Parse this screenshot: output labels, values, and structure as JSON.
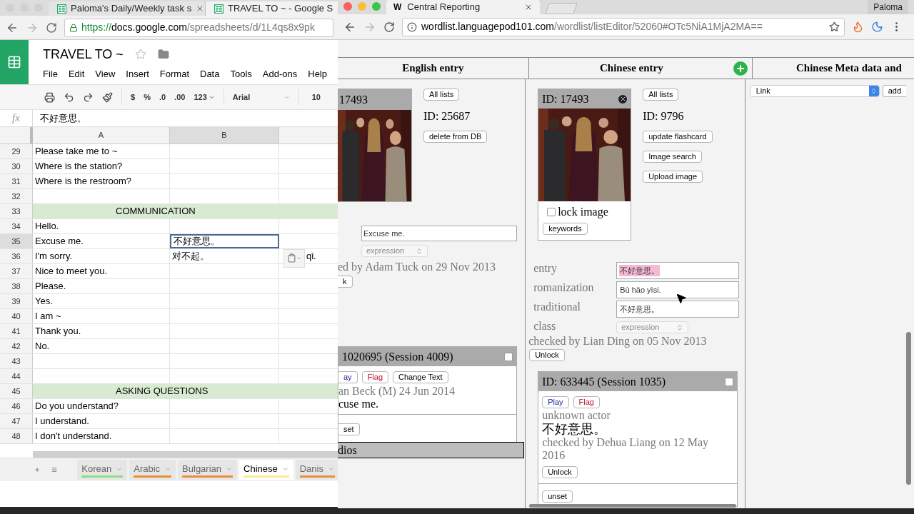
{
  "left_window": {
    "tabs": [
      {
        "title": "Paloma's Daily/Weekly task s",
        "selected": false
      },
      {
        "title": "TRAVEL TO ~ - Google S",
        "selected": true
      }
    ],
    "address": {
      "scheme": "https://",
      "host": "docs.google.com",
      "path": "/spreadsheets/d/1L4qs8x9pk"
    },
    "doc_title": "TRAVEL TO ~",
    "menu": [
      "File",
      "Edit",
      "View",
      "Insert",
      "Format",
      "Data",
      "Tools",
      "Add-ons",
      "Help"
    ],
    "toolbar": {
      "currency": "$",
      "percent": "%",
      "decrease_decimals": ".0",
      "increase_decimals": ".00",
      "number_format": "123",
      "font": "Arial",
      "font_size": "10"
    },
    "formula": {
      "label": "fx",
      "value": "不好意思。"
    },
    "columns": [
      "A",
      "B"
    ],
    "rows": [
      {
        "number": "29",
        "kind": "text",
        "a": "Please take me to ~",
        "selected": false
      },
      {
        "number": "30",
        "kind": "text",
        "a": "Where is the station?",
        "selected": false
      },
      {
        "number": "31",
        "kind": "text",
        "a": "Where is the restroom?",
        "selected": false
      },
      {
        "number": "32",
        "kind": "text",
        "selected": false
      },
      {
        "number": "33",
        "kind": "header",
        "a": "COMMUNICATION",
        "selected": false
      },
      {
        "number": "34",
        "kind": "text",
        "a": "Hello.",
        "selected": false
      },
      {
        "number": "35",
        "kind": "text",
        "a": "Excuse me.",
        "b": "不好意思。",
        "selected": true
      },
      {
        "number": "36",
        "kind": "text",
        "a": "I'm sorry.",
        "b": "对不起。",
        "c": "qǐ.",
        "selected": false
      },
      {
        "number": "37",
        "kind": "text",
        "a": "Nice to meet you.",
        "selected": false
      },
      {
        "number": "38",
        "kind": "text",
        "a": "Please.",
        "selected": false
      },
      {
        "number": "39",
        "kind": "text",
        "a": "Yes.",
        "selected": false
      },
      {
        "number": "40",
        "kind": "text",
        "a": "I am ~",
        "selected": false
      },
      {
        "number": "41",
        "kind": "text",
        "a": "Thank you.",
        "selected": false
      },
      {
        "number": "42",
        "kind": "text",
        "a": "No.",
        "selected": false
      },
      {
        "number": "43",
        "kind": "text",
        "selected": false
      },
      {
        "number": "44",
        "kind": "text",
        "selected": false
      },
      {
        "number": "45",
        "kind": "header",
        "a": "ASKING QUESTIONS",
        "selected": false
      },
      {
        "number": "46",
        "kind": "text",
        "a": "Do you understand?",
        "selected": false
      },
      {
        "number": "47",
        "kind": "text",
        "a": "I understand.",
        "selected": false
      },
      {
        "number": "48",
        "kind": "text",
        "a": "I don't understand.",
        "selected": false
      }
    ],
    "sheets": [
      {
        "name": "Korean",
        "color": "#86e086",
        "selected": false
      },
      {
        "name": "Arabic",
        "color": "#e69138",
        "selected": false
      },
      {
        "name": "Bulgarian",
        "color": "#e69138",
        "selected": false
      },
      {
        "name": "Chinese",
        "color": "#ffe599",
        "selected": true
      },
      {
        "name": "Danis",
        "color": "#e69138",
        "selected": false
      }
    ]
  },
  "right_window": {
    "tab": {
      "icon_letter": "W",
      "title": "Central Reporting"
    },
    "profile": "Paloma",
    "address": {
      "host": "wordlist.languagepod101.com",
      "path": "/wordlist/listEditor/52060#OTc5NiA1MjA2MA=="
    },
    "columns": [
      "English entry",
      "Chinese entry",
      "Chinese Meta data and"
    ],
    "english": {
      "image_id": "17493",
      "all_lists": "All lists",
      "id": "ID: 25687",
      "delete": "delete from DB",
      "entry_value": "Excuse me.",
      "class_value": "expression",
      "checked_by": "ed by Adam Tuck on 29 Nov 2013",
      "unlock": "k",
      "audio": {
        "header": "1020695 (Session 4009)",
        "checked": false,
        "buttons": [
          {
            "label": "ay",
            "kind": "play"
          },
          {
            "label": "Flag",
            "kind": "flag"
          },
          {
            "label": "Change Text",
            "kind": "plain"
          }
        ],
        "actor": "an Beck (M) 24 Jun 2014",
        "text": "cuse me.",
        "unset": "set"
      },
      "audios_bar": "dios"
    },
    "chinese": {
      "image_id": "ID: 17493",
      "lock_label": "lock image",
      "lock_checked": false,
      "keywords": "keywords",
      "all_lists": "All lists",
      "id": "ID: 9796",
      "actions": [
        "update flashcard",
        "Image search",
        "Upload image"
      ],
      "fields": [
        {
          "label": "entry",
          "kind": "text",
          "value": "不好意思。",
          "highlighted": true
        },
        {
          "label": "romanization",
          "kind": "text",
          "value": "Bù hǎo yìsi.",
          "highlighted": false
        },
        {
          "label": "traditional",
          "kind": "text",
          "value": "不好意思。",
          "highlighted": false
        },
        {
          "label": "class",
          "kind": "select",
          "value": "expression"
        }
      ],
      "checked_by": "checked by Lian Ding on 05 Nov 2013",
      "unlock": "Unlock",
      "audio": {
        "header": "ID: 633445 (Session 1035)",
        "checked": false,
        "buttons": [
          {
            "label": "Play",
            "kind": "play"
          },
          {
            "label": "Flag",
            "kind": "flag"
          }
        ],
        "actor": "unknown actor",
        "text": "不好意思。",
        "checked_by": "checked by Dehua Liang on 12 May 2016",
        "unlock": "Unlock",
        "unset": "unset"
      }
    },
    "meta": {
      "select_value": "Link",
      "add": "add"
    }
  }
}
